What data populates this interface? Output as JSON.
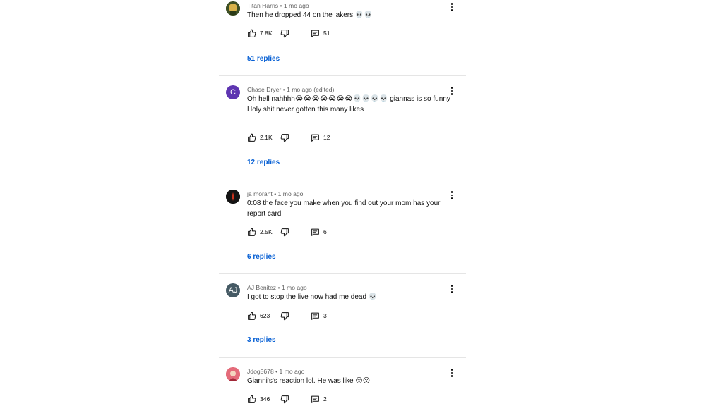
{
  "comments": [
    {
      "author": "Titan Harris",
      "time": "• 1 mo ago",
      "lines": [
        "Then he dropped 44 on the lakers 💀💀"
      ],
      "likes": "7.8K",
      "reply_count": "51",
      "replies_label": "51 replies",
      "avatar_letter": "",
      "avatar_color": "#4a5b2f"
    },
    {
      "author": "Chase Dryer",
      "time": "• 1 mo ago (edited)",
      "lines": [
        "Oh hell nahhhh😭😭😭😭😭😭😭💀💀💀💀 giannas is so funny",
        "Holy shit never gotten this many likes"
      ],
      "likes": "2.1K",
      "reply_count": "12",
      "replies_label": "12 replies",
      "avatar_letter": "C",
      "avatar_color": "#5e35b1"
    },
    {
      "author": "ja morant",
      "time": "• 1 mo ago",
      "lines": [
        "0:08 the face you make when you find out your mom has your report card"
      ],
      "likes": "2.5K",
      "reply_count": "6",
      "replies_label": "6 replies",
      "avatar_letter": "",
      "avatar_color": "#1a1a1a"
    },
    {
      "author": "AJ Benitez",
      "time": "• 1 mo ago",
      "lines": [
        "I got to stop the live now had me dead 💀"
      ],
      "likes": "623",
      "reply_count": "3",
      "replies_label": "3 replies",
      "avatar_letter": "AJ",
      "avatar_color": "#455a64"
    },
    {
      "author": "Jdog5678",
      "time": "• 1 mo ago",
      "lines": [
        "Gianni's's reaction lol. He was like 😮😮"
      ],
      "likes": "346",
      "reply_count": "2",
      "replies_label": "",
      "avatar_letter": "",
      "avatar_color": "#e05a6a"
    }
  ],
  "colors": {
    "link": "#065fd4",
    "meta": "#606060",
    "divider": "#e5e5e5"
  },
  "icons": {
    "like": "thumb-up-icon",
    "dislike": "thumb-down-icon",
    "reply": "comment-icon",
    "menu": "more-vert-icon"
  }
}
